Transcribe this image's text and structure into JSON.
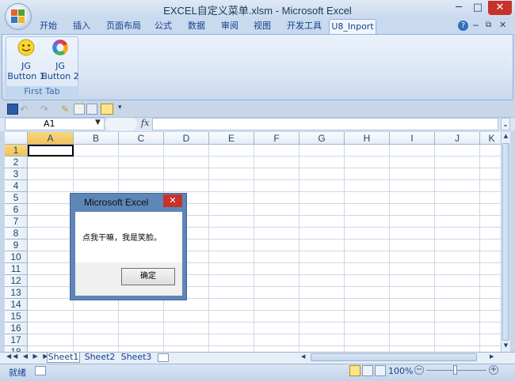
{
  "window": {
    "title": "EXCEL自定义菜单.xlsm - Microsoft Excel"
  },
  "ribbon": {
    "tabs": [
      "开始",
      "插入",
      "页面布局",
      "公式",
      "数据",
      "审阅",
      "视图",
      "开发工具",
      "U8_Inport"
    ],
    "active_tab": "U8_Inport",
    "group_label": "First Tab",
    "buttons": [
      {
        "label_line1": "JG",
        "label_line2": "Button 1"
      },
      {
        "label_line1": "JG",
        "label_line2": "Button 2"
      }
    ]
  },
  "formula_bar": {
    "name_box": "A1",
    "fx": "fx",
    "value": ""
  },
  "grid": {
    "columns": [
      "A",
      "B",
      "C",
      "D",
      "E",
      "F",
      "G",
      "H",
      "I",
      "J",
      "K"
    ],
    "rows": [
      "1",
      "2",
      "3",
      "4",
      "5",
      "6",
      "7",
      "8",
      "9",
      "10",
      "11",
      "12",
      "13",
      "14",
      "15",
      "16",
      "17",
      "18"
    ],
    "selected_cell": "A1"
  },
  "sheets": {
    "tabs": [
      "Sheet1",
      "Sheet2",
      "Sheet3"
    ],
    "active": "Sheet1"
  },
  "status": {
    "ready": "就绪",
    "zoom": "100%"
  },
  "dialog": {
    "title": "Microsoft Excel",
    "close_glyph": "✕",
    "message": "点我干嘛，我是笑脸。",
    "ok_label": "确定"
  },
  "colors": {
    "ribbon_text": "#15428b",
    "dialog_frame": "#5e86b8",
    "close_red": "#c7322b",
    "selected_header": "#f2c05a"
  }
}
